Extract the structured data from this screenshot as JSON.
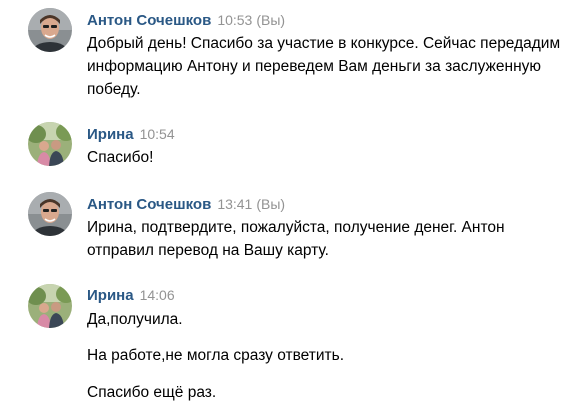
{
  "messages": [
    {
      "author": "Антон Сочешков",
      "time": "10:53",
      "you_label": "(Вы)",
      "lines": [
        "Добрый день! Спасибо за участие в конкурсе. Сейчас передадим информацию Антону и переведем Вам деньги за заслуженную победу."
      ]
    },
    {
      "author": "Ирина",
      "time": "10:54",
      "lines": [
        "Спасибо!"
      ]
    },
    {
      "author": "Антон Сочешков",
      "time": "13:41",
      "you_label": "(Вы)",
      "lines": [
        "Ирина, подтвердите, пожалуйста, получение денег. Антон отправил перевод на Вашу карту."
      ]
    },
    {
      "author": "Ирина",
      "time": "14:06",
      "lines": [
        "Да,получила.",
        "На работе,не могла сразу ответить.",
        "Спасибо ещё раз."
      ]
    }
  ],
  "colors": {
    "author_name": "#2a5885",
    "timestamp": "#939393",
    "text": "#000000",
    "background": "#ffffff"
  },
  "icons": {
    "anton_avatar": "user-avatar-photo",
    "irina_avatar": "user-avatar-photo"
  }
}
